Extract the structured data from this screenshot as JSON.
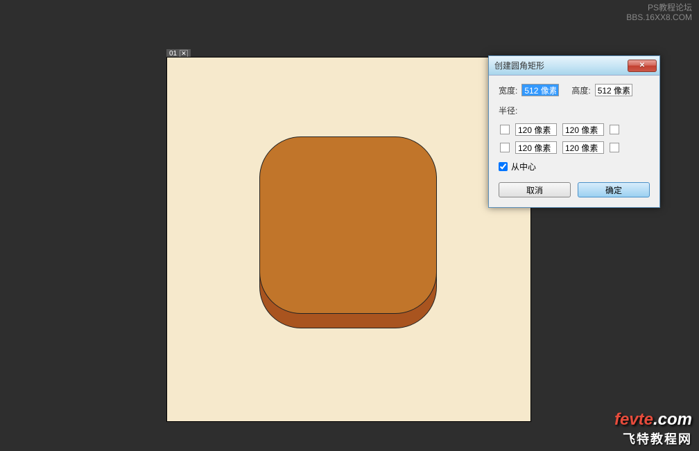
{
  "watermark_top": {
    "line1": "PS教程论坛",
    "line2": "BBS.16XX8.COM"
  },
  "watermark_bottom": {
    "brand_part1": "fevte",
    "brand_part2": ".com",
    "subtitle": "飞特教程网"
  },
  "canvas_tab": {
    "label": "01"
  },
  "dialog": {
    "title": "创建圆角矩形",
    "width_label": "宽度:",
    "width_value": "512 像素",
    "height_label": "高度:",
    "height_value": "512 像素",
    "radius_label": "半径:",
    "radius_tl": "120 像素",
    "radius_tr": "120 像素",
    "radius_bl": "120 像素",
    "radius_br": "120 像素",
    "from_center_label": "从中心",
    "from_center_checked": true,
    "cancel_label": "取消",
    "ok_label": "确定"
  }
}
